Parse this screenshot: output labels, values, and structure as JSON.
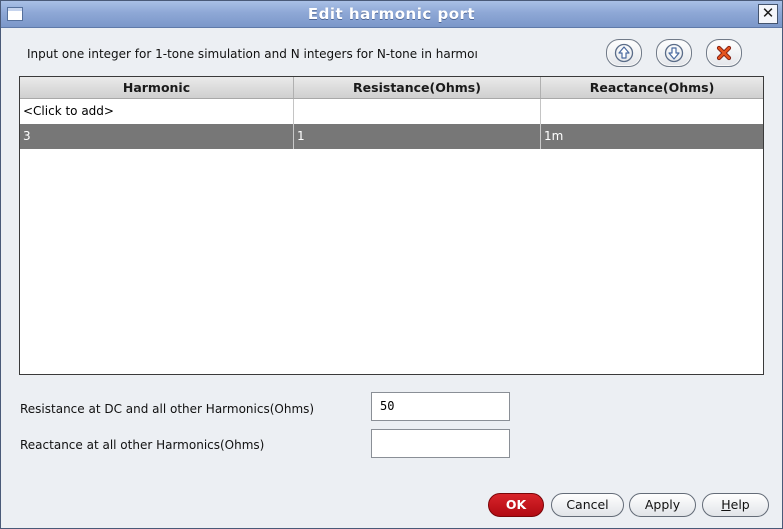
{
  "window": {
    "title": "Edit harmonic port",
    "close_glyph": "✕"
  },
  "instruction": "Input one integer for 1-tone simulation and N integers for N-tone in harmoı",
  "toolbar": {
    "move_up_icon": "arrow-up-icon",
    "move_down_icon": "arrow-down-icon",
    "delete_icon": "delete-x-icon"
  },
  "table": {
    "columns": [
      "Harmonic",
      "Resistance(Ohms)",
      "Reactance(Ohms)"
    ],
    "add_row_text": "<Click to add>",
    "rows": [
      {
        "harmonic": "3",
        "resistance": "1",
        "reactance": "1m",
        "selected": true
      }
    ]
  },
  "fields": {
    "resistance_label": "Resistance at DC and all other Harmonics(Ohms)",
    "resistance_value": "50",
    "reactance_label": "Reactance at all other Harmonics(Ohms)",
    "reactance_value": ""
  },
  "buttons": {
    "ok": "OK",
    "cancel": "Cancel",
    "apply": "Apply",
    "help_mnemonic": "H",
    "help_rest": "elp"
  },
  "colors": {
    "ok_button": "#c8141b",
    "selected_row": "#777777",
    "titlebar": "#8ea8d6"
  }
}
